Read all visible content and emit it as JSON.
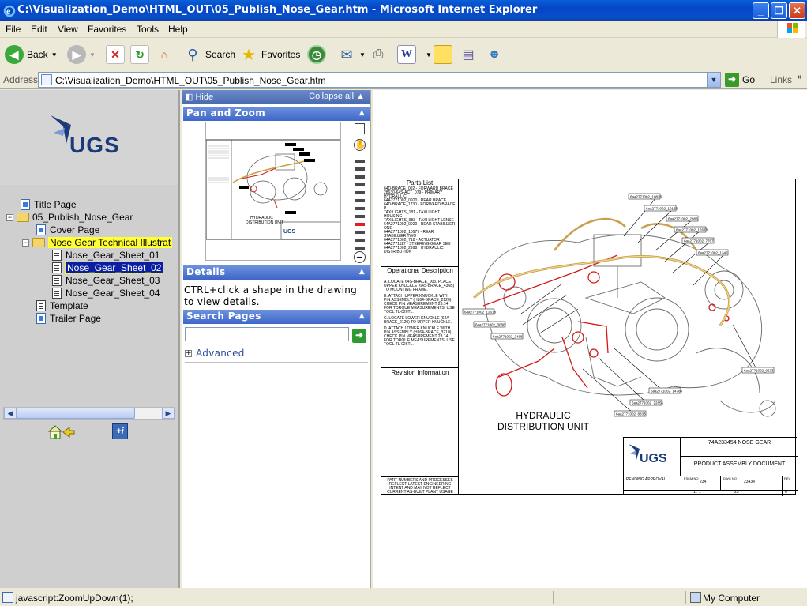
{
  "window": {
    "title": "C:\\Visualization_Demo\\HTML_OUT\\05_Publish_Nose_Gear.htm - Microsoft Internet Explorer",
    "minimize": "_",
    "maximize": "❐",
    "close": "✕"
  },
  "menu": [
    "File",
    "Edit",
    "View",
    "Favorites",
    "Tools",
    "Help"
  ],
  "toolbar": {
    "back": "Back",
    "search": "Search",
    "favorites": "Favorites"
  },
  "address": {
    "label": "Address",
    "url": "C:\\Visualization_Demo\\HTML_OUT\\05_Publish_Nose_Gear.htm",
    "go": "Go",
    "links": "Links"
  },
  "sidebar": {
    "logo_text": "UGS",
    "tree": [
      {
        "label": "Title Page"
      },
      {
        "label": "05_Publish_Nose_Gear"
      },
      {
        "label": "Cover Page"
      },
      {
        "label": "Nose Gear Technical Illustrat"
      },
      {
        "label": "Nose_Gear_Sheet_01"
      },
      {
        "label": "Nose_Gear_Sheet_02"
      },
      {
        "label": "Nose_Gear_Sheet_03"
      },
      {
        "label": "Nose_Gear_Sheet_04"
      },
      {
        "label": "Template"
      },
      {
        "label": "Trailer Page"
      }
    ],
    "selected": "Nose_Gear_Sheet_02"
  },
  "panel": {
    "hide": "Hide",
    "collapse_all": "Collapse all",
    "pan_zoom": "Pan and Zoom",
    "details": "Details",
    "details_text": "CTRL+click a shape in the drawing to view details.",
    "search_pages": "Search Pages",
    "search_value": "",
    "advanced": "Advanced",
    "zoom_level": 0.55
  },
  "drawing": {
    "parts_list_title": "Parts List",
    "parts": [
      "64D-BRACE_002 - FORWARD BRACE",
      "28630-64S-ACT_079 - PRIMARY HYDRAULIC",
      "64A2771002_0920 - REAR BRACE",
      "64D-BRACE_1730 - FORWARD BRACE P",
      "TAXILIGHTS_181 - TAXI LIGHT HOUSING",
      "TAXILIGHTS_983 - TAXI LIGHT LENSE",
      "64A2771002_0920 - REAR STABILIZER ONE",
      "64A2771002_10977 - REAR STABILIZER TWO",
      "64A2771002_718 - ACTUATOR",
      "64A2771117 - STEERING GEAR SEE",
      "64A2771002_2998 - HYDRAULIC DISTRIBUTION"
    ],
    "op_title": "Operational Description",
    "ops": [
      "A. LOCATE 64S-BRACE_003. PLACE UPPER KNUCKLE (64S-BRACE_436B) TO MOUNTING FRAME.",
      "B. ATTACH UPPER KNUCKLE WITH PIN ASSEMBLY (HL64-BRACE_2120). CHECK PIN MEASUREMENT 23.14 FOR TORQUE MEASUREMENTS. USE TOOL TL-026TL.",
      "C. LOCATE LOWER KNUCKLE (64A-BRACE_2120) TO UPPER KNUCKLE.",
      "D. ATTACH LOWER KNUCKLE WITH PIN ASSEMBLY (HL64-BRACE_3210). CHECK PIN MEASUREMENT 23.14 FOR TORQUE MEASUREMENTS. USE TOOL TL-026TL."
    ],
    "rev_title": "Revision Information",
    "disclaimer": "PART NUMBERS AND PROCESSES REFLECT LATEST ENGINEERING INTENT AND MAY NOT REFLECT CURRENT AS-BUILT PLANT USAGE",
    "caption_line1": "HYDRAULIC",
    "caption_line2": "DISTRIBUTION UNIT",
    "callouts": [
      "6aa2771002_10828",
      "6aa2771002_10133",
      "6aa2771002_2988",
      "6aa2771002_12678",
      "6aa2771002_7767",
      "6aa2771002_1342",
      "6aa2771002_12618",
      "6aa2771002_3088",
      "6aa2771002_2488",
      "6aa2771002_9633",
      "6aa2771002_14780",
      "6aa2771002_22855",
      "6aa2771002_8833"
    ],
    "tb_title": "74A233454 NOSE GEAR",
    "tb_doc": "PRODUCT ASSEMBLY DOCUMENT",
    "tb_logo": "UGS",
    "tb_status": "PENDING APPROVAL",
    "tb_fscm_label": "FSCM NO",
    "tb_fscm": "234",
    "tb_dwg_label": "DWG NO",
    "tb_dwg": "23434",
    "tb_rev_label": "REV",
    "tb_scale": "1 : 1",
    "tb_wt": "23",
    "tb_sheet": "6"
  },
  "status": {
    "text": "javascript:ZoomUpDown(1);",
    "zone": "My Computer"
  },
  "colors": {
    "title_bar": "#0a4fc8",
    "selection": "#0a1fa0",
    "highlight": "#ffff33",
    "section_header": "#3d66c8"
  }
}
